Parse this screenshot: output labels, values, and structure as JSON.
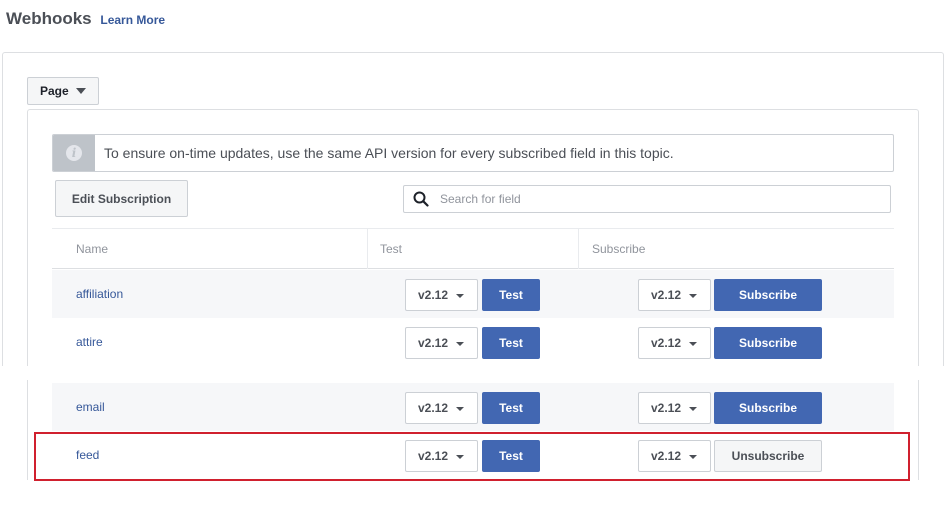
{
  "header": {
    "title": "Webhooks",
    "learn_more": "Learn More"
  },
  "topic_select": {
    "value": "Page",
    "icon": "caret-down-icon"
  },
  "notice": {
    "icon": "info-icon",
    "text": "To ensure on-time updates, use the same API version for every subscribed field in this topic."
  },
  "toolbar": {
    "edit_label": "Edit Subscription",
    "search_icon": "search-icon",
    "search_placeholder": "Search for field"
  },
  "table": {
    "columns": [
      "Name",
      "Test",
      "Subscribe"
    ],
    "rows": [
      {
        "name": "affiliation",
        "test_version": "v2.12",
        "test_label": "Test",
        "subscribe_version": "v2.12",
        "subscribe_label": "Subscribe",
        "subscribed": false
      },
      {
        "name": "attire",
        "test_version": "v2.12",
        "test_label": "Test",
        "subscribe_version": "v2.12",
        "subscribe_label": "Subscribe",
        "subscribed": false
      },
      {
        "name": "email",
        "test_version": "v2.12",
        "test_label": "Test",
        "subscribe_version": "v2.12",
        "subscribe_label": "Subscribe",
        "subscribed": false
      },
      {
        "name": "feed",
        "test_version": "v2.12",
        "test_label": "Test",
        "subscribe_version": "v2.12",
        "subscribe_label": "Unsubscribe",
        "subscribed": true
      }
    ]
  },
  "colors": {
    "primary_button": "#4267b2",
    "link": "#365899",
    "highlight_outline": "#d0202e"
  }
}
